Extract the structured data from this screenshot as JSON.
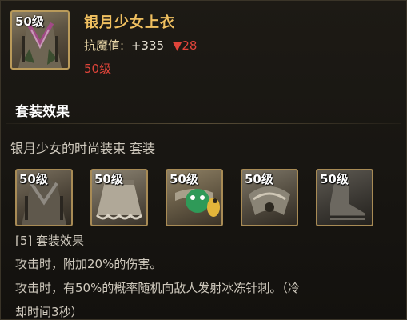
{
  "item": {
    "level_badge": "50级",
    "name": "银月少女上衣",
    "stat": {
      "label": "抗魔值:",
      "value": "+335",
      "change": "▼28"
    },
    "required_level": "50级",
    "icon": "robe-top-icon"
  },
  "set": {
    "section_title": "套装效果",
    "set_name": "银月少女的时尚装束 套装",
    "pieces": [
      {
        "level_badge": "50级",
        "icon": "robe-top-icon"
      },
      {
        "level_badge": "50级",
        "icon": "skirt-icon"
      },
      {
        "level_badge": "50级",
        "icon": "belt-icon"
      },
      {
        "level_badge": "50级",
        "icon": "shoulder-icon"
      },
      {
        "level_badge": "50级",
        "icon": "shoes-icon"
      }
    ],
    "bonus_title": "[5] 套装效果",
    "bonus_lines": [
      "攻击时，附加20%的伤害。",
      "攻击时，有50%的概率随机向敌人发射冰冻针刺。（冷",
      "却时间3秒）"
    ]
  },
  "colors": {
    "name": "#f0c060",
    "warning": "#e0443a",
    "frame": "#a88b55"
  }
}
